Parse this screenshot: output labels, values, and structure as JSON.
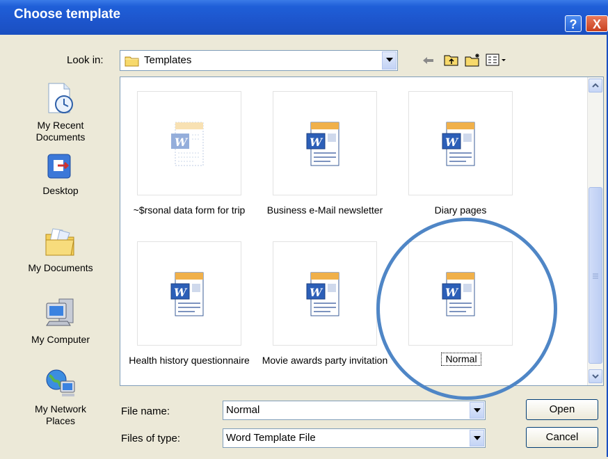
{
  "window": {
    "title": "Choose template",
    "help_label": "?",
    "close_label": "X"
  },
  "toolbar": {
    "look_in_label": "Look in:",
    "look_in_value": "Templates"
  },
  "places": [
    {
      "label": "My Recent\nDocuments",
      "icon": "recent-documents-icon"
    },
    {
      "label": "Desktop",
      "icon": "desktop-icon"
    },
    {
      "label": "My Documents",
      "icon": "my-documents-icon"
    },
    {
      "label": "My Computer",
      "icon": "my-computer-icon"
    },
    {
      "label": "My Network\nPlaces",
      "icon": "network-places-icon"
    }
  ],
  "files": [
    {
      "name": "~$rsonal data form for trip",
      "icon": "word-template-ghost-icon"
    },
    {
      "name": "Business e-Mail newsletter",
      "icon": "word-template-icon"
    },
    {
      "name": "Diary pages",
      "icon": "word-template-icon"
    },
    {
      "name": "Health history questionnaire",
      "icon": "word-template-icon"
    },
    {
      "name": "Movie awards party invitation",
      "icon": "word-template-icon"
    },
    {
      "name": "Normal",
      "icon": "word-template-icon",
      "selected": true
    }
  ],
  "form": {
    "file_name_label": "File name:",
    "file_name_value": "Normal",
    "file_type_label": "Files of type:",
    "file_type_value": "Word Template File"
  },
  "buttons": {
    "open": "Open",
    "cancel": "Cancel"
  },
  "colors": {
    "titlebar": "#1f5fd8",
    "highlight_circle": "#4f86c6",
    "dialog_bg": "#ece9d8"
  }
}
